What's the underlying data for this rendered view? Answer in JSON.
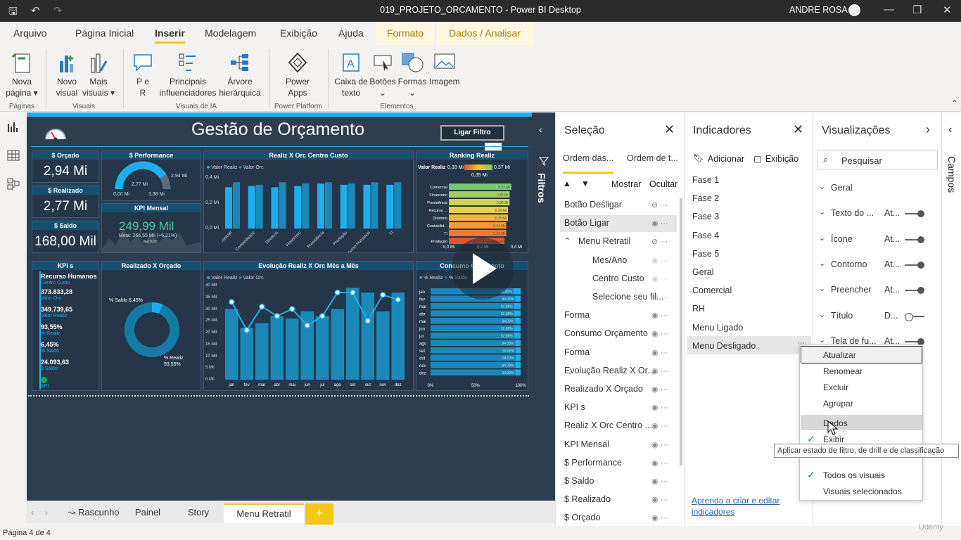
{
  "window": {
    "title": "019_PROJETO_ORCAMENTO - Power BI Desktop",
    "user": "ANDRE ROSA"
  },
  "tabs": [
    "Arquivo",
    "Página Inicial",
    "Inserir",
    "Modelagem",
    "Exibição",
    "Ajuda"
  ],
  "context_tabs": [
    "Formato",
    "Dados / Analisar"
  ],
  "ribbon": {
    "nova_pagina": [
      "Nova",
      "página ▾"
    ],
    "novo_visual": [
      "Novo",
      "visual"
    ],
    "mais_visuais": [
      "Mais",
      "visuais ▾"
    ],
    "pe_r": [
      "P e",
      "R"
    ],
    "principais": [
      "Principais",
      "influenciadores"
    ],
    "arvore": [
      "Árvore",
      "hierárquica"
    ],
    "power_apps": [
      "Power",
      "Apps"
    ],
    "caixa_texto": [
      "Caixa de",
      "texto"
    ],
    "botoes": [
      "Botões",
      "⌄"
    ],
    "formas": [
      "Formas",
      "⌄"
    ],
    "imagem": [
      "Imagem",
      ""
    ],
    "groups": [
      "Páginas",
      "Visuais",
      "Visuais de IA",
      "Power Platform",
      "Elementos"
    ]
  },
  "report": {
    "title": "Gestão de Orçamento",
    "button": "Ligar Filtro",
    "kpis": [
      {
        "label": "$ Orçado",
        "value": "2,94 Mi"
      },
      {
        "label": "$ Realizado",
        "value": "2,77 Mi"
      },
      {
        "label": "$ Saldo",
        "value": "168,00 Mil"
      }
    ],
    "performance": {
      "title": "$ Performance",
      "value": "2,77 Mi",
      "min": "0,00 Mi",
      "max": "3,38 Mi",
      "target": "2,94 Mi",
      "fraction": 0.82
    },
    "kpi_mensal": {
      "title": "KPI Mensal",
      "value": "249,99 Mil",
      "meta": "Meta: 266,55 Mil (+6,21%)",
      "date": "dez/2020"
    },
    "centro_custo": {
      "title": "Realiz X Orc Centro Custo",
      "legend": [
        "Valor Realiz",
        "Valor Orc"
      ],
      "yticks": [
        "0,4 Mi",
        "0,2 Mi",
        "0,0 Mi"
      ]
    },
    "ranking": {
      "title": "Ranking Realiz",
      "legend_label": "Valor Realiz",
      "min": "0,33 Mi",
      "max": "0,37 Mi",
      "mid": "0,35 Mi"
    },
    "kpis_panel": {
      "title": "KPI s",
      "heading": "Recurso Humanos",
      "sub": "Centro Custo",
      "items": [
        {
          "value": "373.833,28",
          "label": "Valor Orc"
        },
        {
          "value": "349.739,65",
          "label": "Valor Realiz"
        },
        {
          "value": "93,55%",
          "label": "% Realiz"
        },
        {
          "value": "6,45%",
          "label": "% Saldo"
        },
        {
          "value": "24.093,63",
          "label": "$ Saldo"
        }
      ],
      "foot": "KPI"
    },
    "donut": {
      "title": "Realizado X Orçado",
      "saldo": "% Saldo 6,45%",
      "realiz": [
        "% Realiz",
        "93,55%"
      ],
      "fraction": 0.9355
    },
    "evolucao": {
      "title": "Evolução Realiz X Orc Mês a Mês",
      "legend": [
        "Valor Realiz",
        "Valor Orc"
      ],
      "yticks": [
        "40 Mil",
        "35 Mil",
        "30 Mil",
        "25 Mil",
        "20 Mil",
        "15 Mil",
        "10 Mil",
        "5 Mil",
        "0 Mil"
      ]
    },
    "consumo": {
      "title": "Consumo Orçamento",
      "legend": [
        "% Realiz",
        "% Saldo"
      ],
      "xticks": [
        "0%",
        "50%",
        "100%"
      ]
    }
  },
  "chart_data": [
    {
      "type": "bar",
      "title": "Realiz X Orc Centro Custo",
      "categories": [
        "Comercial",
        "Contabilidade",
        "Diretoria",
        "Financeiro",
        "Presidência",
        "Produção",
        "Recurso Humanos",
        "TI"
      ],
      "series": [
        {
          "name": "Valor Realiz",
          "values": [
            0.33,
            0.34,
            0.33,
            0.34,
            0.36,
            0.35,
            0.35,
            0.35
          ]
        },
        {
          "name": "Valor Orc",
          "values": [
            0.37,
            0.35,
            0.37,
            0.36,
            0.37,
            0.36,
            0.37,
            0.37
          ]
        }
      ],
      "ylim": [
        0,
        0.45
      ],
      "colors": {
        "realiz": "#1ab0ef",
        "orc": "#1a89b8"
      }
    },
    {
      "type": "bar",
      "title": "Ranking Realiz",
      "categories": [
        "Comercial",
        "Financeiro",
        "Presidência",
        "Recurso ...",
        "Diretoria",
        "Contabilid...",
        "TI",
        "Produção"
      ],
      "values": [
        0.37,
        0.36,
        0.36,
        0.35,
        0.35,
        0.34,
        0.34,
        0.33
      ],
      "labels": [
        "0,37 Mi",
        "0,36 Mi",
        "0,36 Mi",
        "0,35 Mi",
        "0,35 Mi",
        "0,34 Mi",
        "0,34 Mi",
        "0,33 Mi"
      ],
      "xticks": [
        "0,0 Mi",
        "0,2 Mi",
        "0,4 Mi"
      ],
      "colors": [
        "#7bc86c",
        "#a6cf5a",
        "#c9d64e",
        "#e8d042",
        "#f2b63a",
        "#f39a34",
        "#f07a2e",
        "#e8542b"
      ]
    },
    {
      "type": "bar",
      "title": "Evolução Realiz X Orc Mês a Mês",
      "categories": [
        "jan",
        "fev",
        "mar",
        "abr",
        "mai",
        "jun",
        "jul",
        "ago",
        "set",
        "out",
        "nov",
        "dez"
      ],
      "series": [
        {
          "name": "Valor Realiz",
          "values": [
            30000,
            22000,
            24000,
            27000,
            26000,
            29000,
            27000,
            30000,
            39000,
            37000,
            29000,
            37000
          ]
        },
        {
          "name": "Valor Orc",
          "values": [
            33000,
            21000,
            31000,
            27000,
            30000,
            23000,
            27000,
            37000,
            37000,
            25000,
            36000,
            34000
          ]
        }
      ],
      "ylim": [
        0,
        40000
      ]
    },
    {
      "type": "bar",
      "title": "Consumo Orçamento",
      "categories": [
        "jan",
        "fev",
        "mar",
        "abr",
        "mai",
        "jun",
        "jul",
        "ago",
        "set",
        "out",
        "nov",
        "dez"
      ],
      "values": [
        0.92,
        0.9408,
        0.9288,
        0.9288,
        0.9408,
        0.9288,
        0.9288,
        0.9408,
        0.9468,
        0.9453,
        0.9408,
        0.9408
      ],
      "labels": [
        "92,00%",
        "94,08%",
        "92,88%",
        "92,88%",
        "94,08%",
        "92,88%",
        "92,88%",
        "94,08%",
        "94,68%",
        "94,53%",
        "94,08%",
        "94,08%"
      ]
    }
  ],
  "filters_label": "Filtros",
  "pages": [
    "Rascunho",
    "Painel",
    "Story",
    "Menu Retratil"
  ],
  "status": "Página 4 de 4",
  "selecao": {
    "title": "Seleção",
    "tab1": "Ordem das...",
    "tab2": "Ordem de t...",
    "mostrar": "Mostrar",
    "ocultar": "Ocultar",
    "items": [
      "Botão Desligar",
      "Botão Ligar",
      "Menu Retratil",
      "Mes/Ano",
      "Centro Custo",
      "Selecione seu fil...",
      "Forma",
      "Consumo Orçamento",
      "Forma",
      "Evolução Realiz X Or...",
      "Realizado X Orçado",
      "KPI s",
      "Realiz X Orc Centro ...",
      "KPI Mensal",
      "$ Performance",
      "$ Saldo",
      "$ Realizado",
      "$ Orçado"
    ]
  },
  "indicadores": {
    "title": "Indicadores",
    "adicionar": "Adicionar",
    "exibicao": "Exibição",
    "items": [
      "Fase 1",
      "Fase 2",
      "Fase 3",
      "Fase 4",
      "Fase 5",
      "Geral",
      "Comercial",
      "RH",
      "Menu Ligado",
      "Menu Desligado"
    ],
    "link": [
      "Aprenda a criar e editar",
      "indicadores"
    ]
  },
  "visualizacoes": {
    "title": "Visualizações",
    "search_placeholder": "Pesquisar",
    "sections": [
      {
        "label": "Geral",
        "value": ""
      },
      {
        "label": "Texto do ...",
        "value": "At..."
      },
      {
        "label": "Ícone",
        "value": "At..."
      },
      {
        "label": "Contorno",
        "value": "At..."
      },
      {
        "label": "Preencher",
        "value": "At..."
      },
      {
        "label": "Título",
        "value": "D..."
      },
      {
        "label": "Tela de fu...",
        "value": "At..."
      }
    ]
  },
  "campos_label": "Campos",
  "context_menu": {
    "items": [
      "Atualizar",
      "Renomear",
      "Excluir",
      "Agrupar",
      "Dados",
      "Exibir",
      "Todos os visuais",
      "Visuais selecionados"
    ],
    "tooltip": "Aplicar estado de filtro, de drill e de classificação"
  },
  "colors": {
    "accent": "#f2c811",
    "report_bg": "#2d3e50",
    "bright_blue": "#1ab0ef"
  }
}
